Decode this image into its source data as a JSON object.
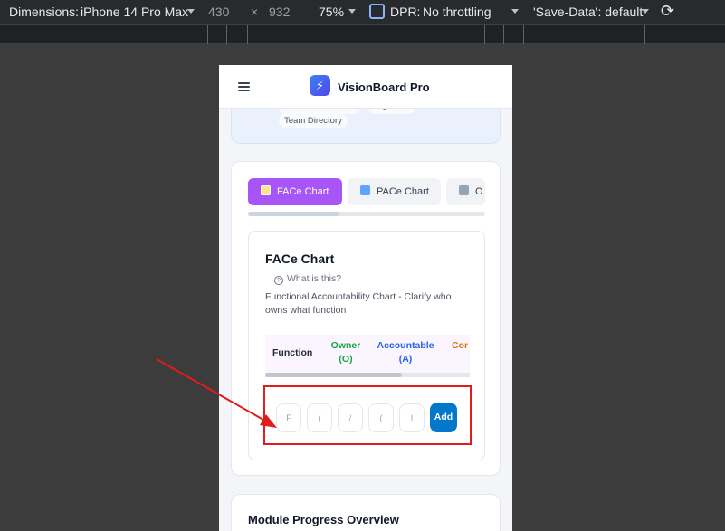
{
  "devtools": {
    "dimensions_label": "Dimensions:",
    "device": "iPhone 14 Pro Max",
    "width": "430",
    "times": "×",
    "height": "932",
    "zoom": "75%",
    "dpr_label": "DPR:",
    "throttling": "No throttling",
    "save_data": "'Save-Data': default",
    "device_icon": "device-frame-icon",
    "rotate_icon": "rotate-icon"
  },
  "app": {
    "brand": "VisionBoard Pro",
    "menu_icon": "hamburger-menu-icon",
    "logo_icon": "lightning-logo-icon"
  },
  "top_chips": [
    "Talent Assessment",
    "Org Chart",
    "Team Directory"
  ],
  "tabs": [
    {
      "label": "FACe Chart",
      "icon": "chart-icon"
    },
    {
      "label": "PACe Chart",
      "icon": "refresh-icon"
    },
    {
      "label": "O",
      "icon": "building-icon"
    }
  ],
  "face": {
    "title": "FACe Chart",
    "what_label": "What is this?",
    "description": "Functional Accountability Chart - Clarify who owns what function",
    "columns": [
      "Function",
      "Owner (O)",
      "Accountable (A)",
      "Cor"
    ],
    "column_colors": [
      "#1f2937",
      "#16a34a",
      "#2563eb",
      "#d97706"
    ],
    "inputs": [
      "F",
      "(",
      "/",
      "(",
      "I"
    ],
    "add_label": "Add"
  },
  "progress_section": {
    "title": "Module Progress Overview"
  },
  "annotation": {
    "highlight_color": "#e21b1b"
  }
}
